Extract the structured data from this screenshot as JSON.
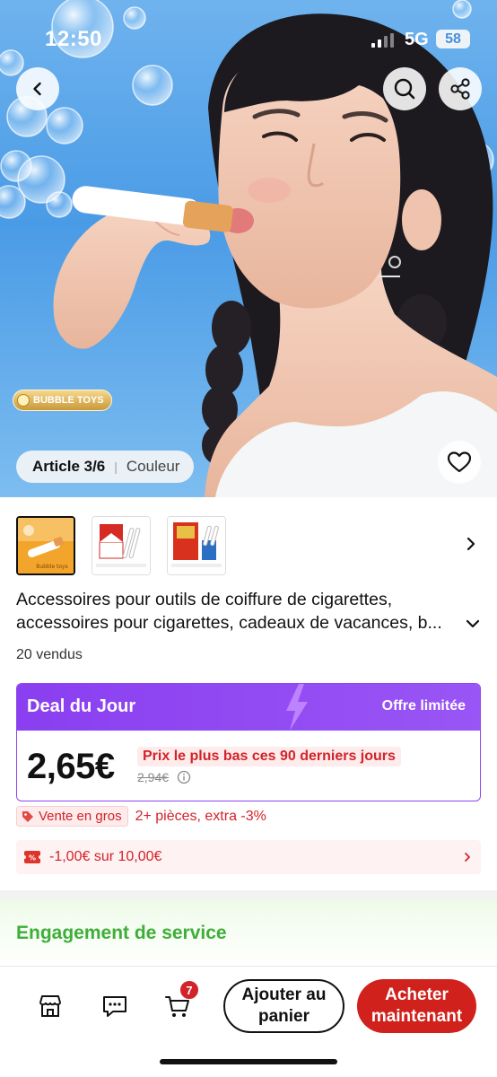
{
  "status_bar": {
    "time": "12:50",
    "network": "5G",
    "battery": "58"
  },
  "hero": {
    "badge_text": "BUBBLE TOYS",
    "article_label": "Article 3/6",
    "variant_label": "Couleur"
  },
  "thumbnails": [
    {
      "name": "thumbnail-1",
      "caption": "Bubble toys"
    },
    {
      "name": "thumbnail-2",
      "caption": ""
    },
    {
      "name": "thumbnail-3",
      "caption": ""
    }
  ],
  "product": {
    "title": "Accessoires pour outils de coiffure de cigarettes, accessoires pour cigarettes, cadeaux de vacances, b...",
    "sold": "20 vendus"
  },
  "deal": {
    "title": "Deal du Jour",
    "limited": "Offre limitée",
    "price": "2,65€",
    "lowest_label": "Prix le plus bas ces 90 derniers jours",
    "old_price": "2,94€"
  },
  "wholesale": {
    "badge": "Vente en gros",
    "text": "2+ pièces, extra -3%"
  },
  "coupon": {
    "text": "-1,00€ sur 10,00€"
  },
  "service": {
    "title": "Engagement de service"
  },
  "bottom_bar": {
    "cart_count": "7",
    "add_to_cart": "Ajouter au panier",
    "buy_now": "Acheter maintenant"
  },
  "colors": {
    "accent_purple": "#8a3ff0",
    "price_red": "#d2232a",
    "buy_red": "#d0211d",
    "service_green": "#3fae38"
  },
  "icons": [
    "back-icon",
    "search-icon",
    "share-icon",
    "heart-icon",
    "chevron-right-icon",
    "chevron-down-icon",
    "info-icon",
    "tag-icon",
    "coupon-icon",
    "store-icon",
    "chat-icon",
    "cart-icon"
  ]
}
